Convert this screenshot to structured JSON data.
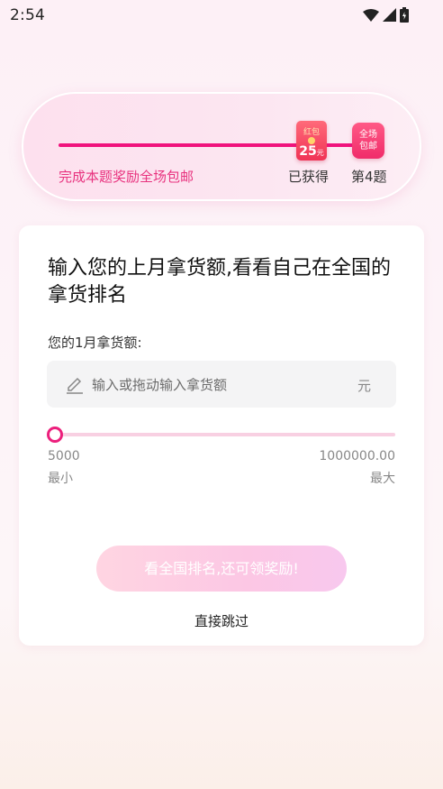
{
  "status_bar": {
    "time": "2:54"
  },
  "progress": {
    "reward_text": "完成本题奖励全场包邮",
    "obtained_label": "已获得",
    "next_question_label": "第4题",
    "redpack": {
      "label": "红包",
      "amount": "25",
      "unit": "元"
    },
    "freeship": {
      "line1": "全场",
      "line2": "包邮"
    },
    "accent_color": "#f0137d"
  },
  "question": {
    "title": "输入您的上月拿货额,看看自己在全国的拿货排名",
    "prompt": "您的1月拿货额:",
    "input_placeholder": "输入或拖动输入拿货额",
    "unit": "元"
  },
  "slider": {
    "min_value": "5000",
    "min_label": "最小",
    "max_value": "1000000.00",
    "max_label": "最大",
    "position": 0
  },
  "actions": {
    "cta_label": "看全国排名,还可领奖励!",
    "skip_label": "直接跳过"
  }
}
